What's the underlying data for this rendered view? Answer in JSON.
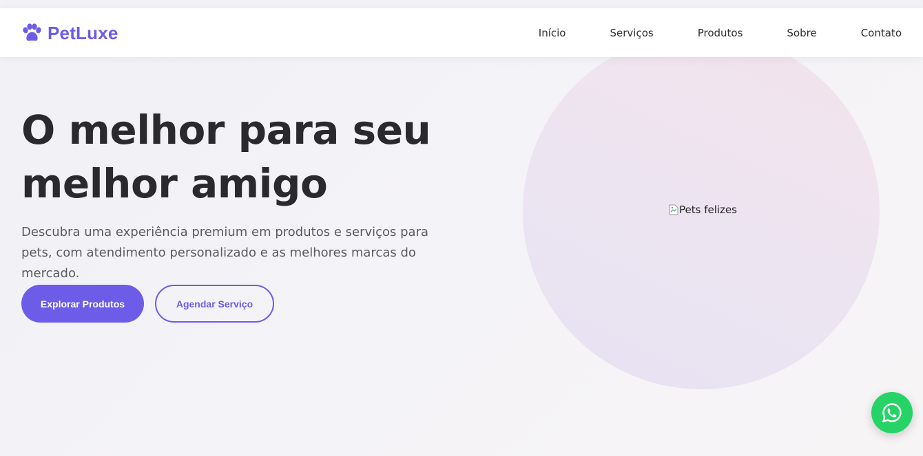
{
  "brand": {
    "name": "PetLuxe",
    "icon": "paw-icon",
    "color": "#6c5ce7"
  },
  "nav": {
    "items": [
      {
        "label": "Início"
      },
      {
        "label": "Serviços"
      },
      {
        "label": "Produtos"
      },
      {
        "label": "Sobre"
      },
      {
        "label": "Contato"
      }
    ]
  },
  "hero": {
    "title": "O melhor para seu melhor amigo",
    "description": "Descubra uma experiência premium em produtos e serviços para pets, com atendimento personalizado e as melhores marcas do mercado.",
    "primary_button": "Explorar Produtos",
    "secondary_button": "Agendar Serviço",
    "image_alt": "Pets felizes"
  },
  "whatsapp": {
    "icon": "whatsapp-icon",
    "color": "#25d366"
  },
  "colors": {
    "accent": "#6c5ce7",
    "text_dark": "#2a2a2e",
    "text_muted": "#5a5a63"
  }
}
